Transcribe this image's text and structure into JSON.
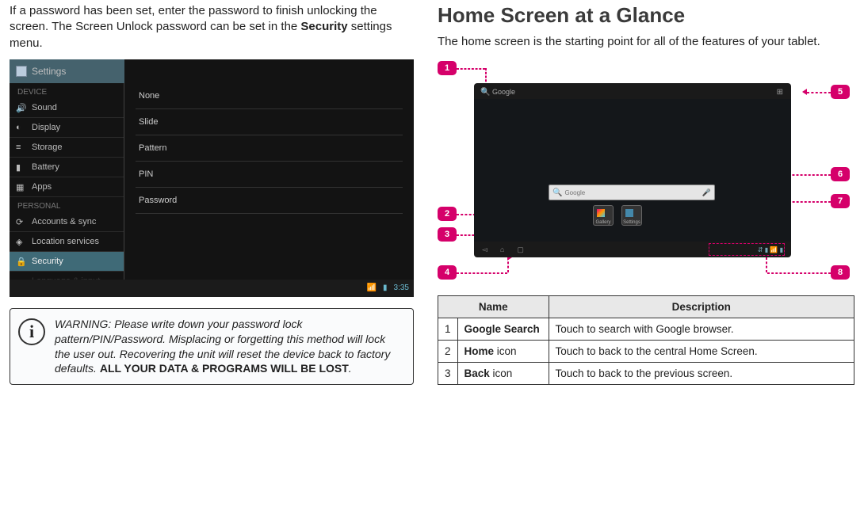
{
  "left": {
    "intro_pre": "If a password has been set, enter the password to finish unlocking the screen. The Screen Unlock password can be set in the ",
    "intro_bold": "Security",
    "intro_post": " settings menu.",
    "settings": {
      "title": "Settings",
      "groups": {
        "device": "DEVICE",
        "personal": "PERSONAL"
      },
      "sidebar": [
        "Sound",
        "Display",
        "Storage",
        "Battery",
        "Apps",
        "Accounts & sync",
        "Location services",
        "Security",
        "Language & input"
      ],
      "options": [
        "None",
        "Slide",
        "Pattern",
        "PIN",
        "Password"
      ],
      "clock": "3:35"
    },
    "warn": {
      "prefix": "WARNING: Please write down your password lock pattern/PIN/Password. Misplacing or forgetting this method will lock the user out. Recovering the unit will reset the device back to factory defaults.",
      "bold": "ALL YOUR DATA & PROGRAMS WILL BE LOST",
      "after": "."
    }
  },
  "right": {
    "heading": "Home Screen at a Glance",
    "subtext": "The home screen is the starting point for all of the features of your tablet.",
    "callouts": [
      "1",
      "2",
      "3",
      "4",
      "5",
      "6",
      "7",
      "8"
    ],
    "tablet": {
      "topsearch": "Google",
      "search_placeholder": "Google",
      "icon_a": "Gallery",
      "icon_b": "Settings"
    },
    "table": {
      "h1": "Name",
      "h2": "Description",
      "rows": [
        {
          "n": "1",
          "name_b": "Google Search",
          "name_r": "",
          "desc": "Touch to search with Google browser."
        },
        {
          "n": "2",
          "name_b": "Home",
          "name_r": " icon",
          "desc": "Touch to back to the central Home Screen."
        },
        {
          "n": "3",
          "name_b": "Back",
          "name_r": " icon",
          "desc": "Touch to back to the previous screen."
        }
      ]
    }
  }
}
